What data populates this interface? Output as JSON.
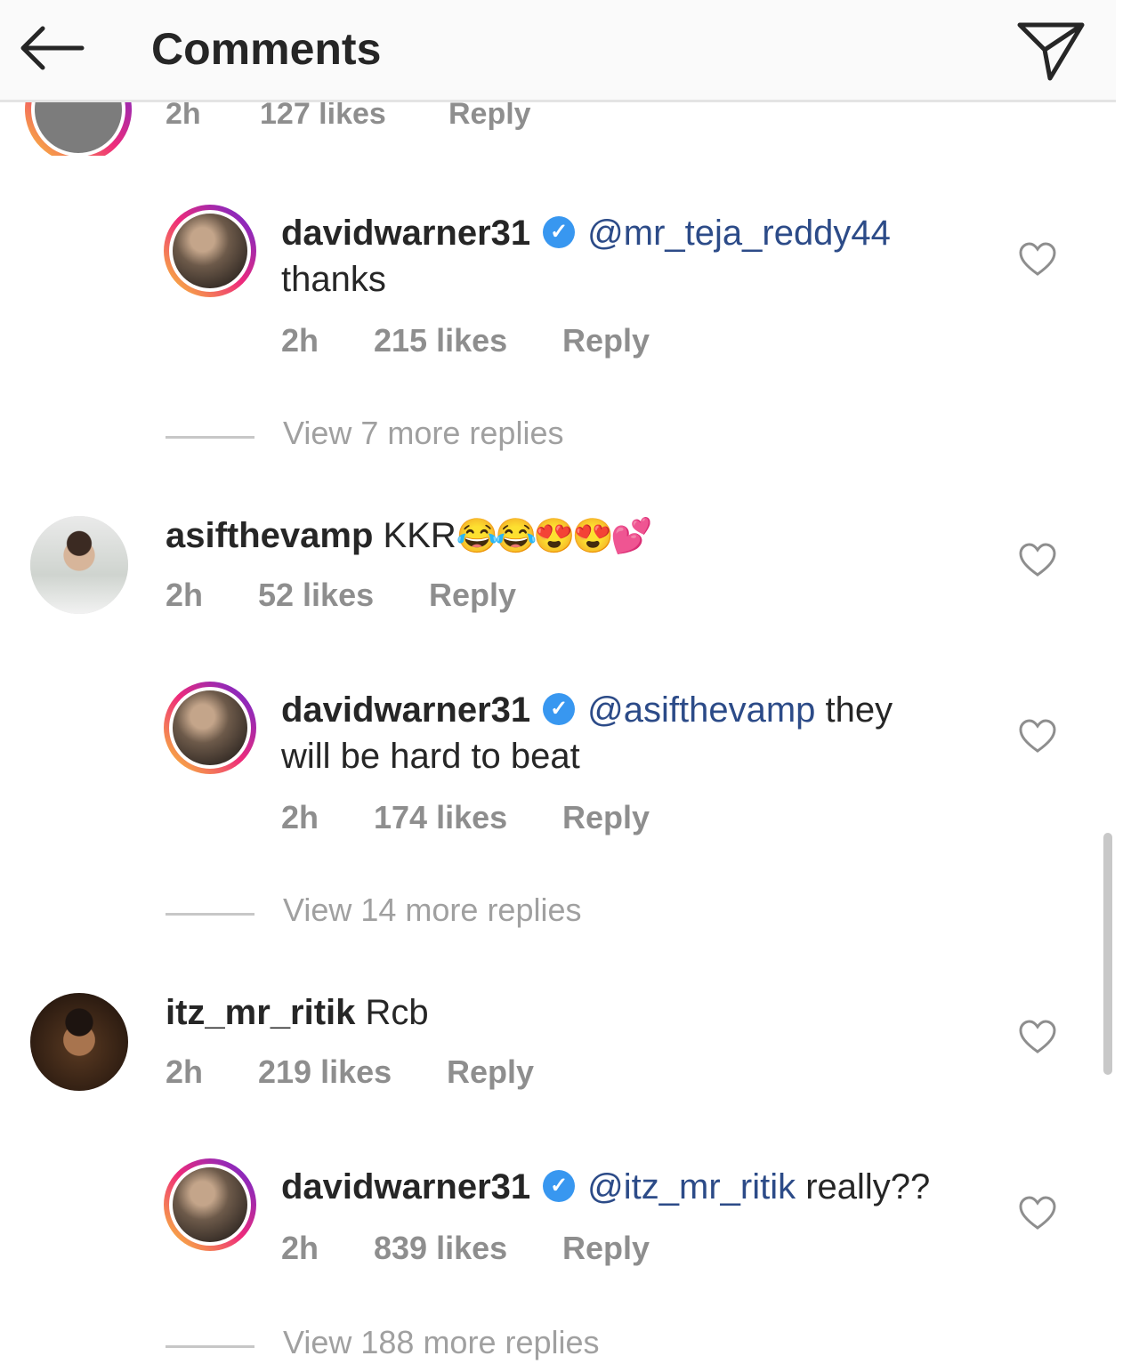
{
  "header": {
    "title": "Comments"
  },
  "partial": {
    "time": "2h",
    "likes": "127 likes",
    "reply": "Reply"
  },
  "comments": [
    {
      "user": "davidwarner31",
      "mention": "@mr_teja_reddy44",
      "text": "thanks",
      "time": "2h",
      "likes": "215 likes",
      "reply": "Reply",
      "verified": true
    },
    {
      "user": "asifthevamp",
      "text": "KKR",
      "emoji": "😂😂😍😍💕",
      "time": "2h",
      "likes": "52 likes",
      "reply": "Reply"
    },
    {
      "user": "davidwarner31",
      "mention": "@asifthevamp",
      "text_1": " they",
      "text_2": "will be hard to beat",
      "time": "2h",
      "likes": "174 likes",
      "reply": "Reply",
      "verified": true
    },
    {
      "user": "itz_mr_ritik",
      "text": "Rcb",
      "time": "2h",
      "likes": "219 likes",
      "reply": "Reply"
    },
    {
      "user": "davidwarner31",
      "mention": "@itz_mr_ritik",
      "text": " really??",
      "time": "2h",
      "likes": "839 likes",
      "reply": "Reply",
      "verified": true
    }
  ],
  "more_replies": [
    "View 7 more replies",
    "View 14 more replies",
    "View 188 more replies"
  ],
  "colors": {
    "verified": "#3897f0",
    "mention": "#2c4b88",
    "meta": "#8e8e8e",
    "story_ring": "#ee2a7b"
  },
  "icons": {
    "back": "arrow-left-icon",
    "send": "send-icon",
    "like": "heart-outline-icon",
    "verified": "verified-badge-icon"
  }
}
